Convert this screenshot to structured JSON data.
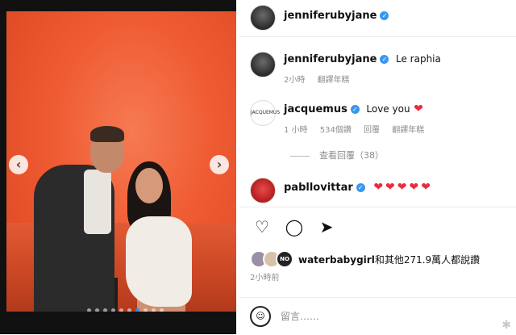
{
  "post": {
    "carousel": {
      "prev_icon": "‹",
      "next_icon": "›",
      "dot_count": 10,
      "active_dot": 6
    }
  },
  "header": {
    "username": "jenniferubyjane",
    "verified": true
  },
  "caption": {
    "username": "jenniferubyjane",
    "text": "Le raphia",
    "time": "2小時",
    "translate": "翻譯年糕"
  },
  "comments": [
    {
      "username": "jacquemus",
      "avatar_text": "JACQUEMUS",
      "text": "Love you",
      "emoji": "❤",
      "time": "1 小時",
      "likes": "534個讚",
      "reply": "回覆",
      "translate": "翻譯年糕",
      "view_replies": "查看回覆（38）"
    },
    {
      "username": "pabllovittar",
      "emojis": "❤❤❤❤❤"
    }
  ],
  "actions": {
    "like_icon": "♡",
    "comment_icon": "◯",
    "share_icon": "➤"
  },
  "likes": {
    "avatars": [
      "",
      "",
      "NO"
    ],
    "user": "waterbabygirl",
    "text": "和其他271.9萬人都說讚"
  },
  "post_time": "2小時前",
  "comment_input": {
    "emoji_icon": "☺",
    "placeholder": "留言……"
  },
  "watermark": "✱"
}
